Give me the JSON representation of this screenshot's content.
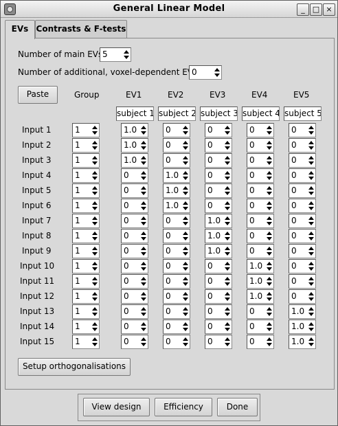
{
  "window": {
    "title": "General Linear Model",
    "min_label": "_",
    "max_label": "□",
    "close_label": "×"
  },
  "tabs": [
    {
      "label": "EVs"
    },
    {
      "label": "Contrasts & F-tests"
    }
  ],
  "main_evs": {
    "label": "Number of main EVs",
    "value": "5"
  },
  "additional_evs": {
    "label": "Number of additional, voxel-dependent EVs",
    "value": "0"
  },
  "paste_label": "Paste",
  "group_header": "Group",
  "ev_headers": [
    "EV1",
    "EV2",
    "EV3",
    "EV4",
    "EV5"
  ],
  "ev_names": [
    "subject 1",
    "subject 2",
    "subject 3",
    "subject 4",
    "subject 5"
  ],
  "rows": [
    {
      "label": "Input 1",
      "group": "1",
      "ev": [
        "1.0",
        "0",
        "0",
        "0",
        "0"
      ]
    },
    {
      "label": "Input 2",
      "group": "1",
      "ev": [
        "1.0",
        "0",
        "0",
        "0",
        "0"
      ]
    },
    {
      "label": "Input 3",
      "group": "1",
      "ev": [
        "1.0",
        "0",
        "0",
        "0",
        "0"
      ]
    },
    {
      "label": "Input 4",
      "group": "1",
      "ev": [
        "0",
        "1.0",
        "0",
        "0",
        "0"
      ]
    },
    {
      "label": "Input 5",
      "group": "1",
      "ev": [
        "0",
        "1.0",
        "0",
        "0",
        "0"
      ]
    },
    {
      "label": "Input 6",
      "group": "1",
      "ev": [
        "0",
        "1.0",
        "0",
        "0",
        "0"
      ]
    },
    {
      "label": "Input 7",
      "group": "1",
      "ev": [
        "0",
        "0",
        "1.0",
        "0",
        "0"
      ]
    },
    {
      "label": "Input 8",
      "group": "1",
      "ev": [
        "0",
        "0",
        "1.0",
        "0",
        "0"
      ]
    },
    {
      "label": "Input 9",
      "group": "1",
      "ev": [
        "0",
        "0",
        "1.0",
        "0",
        "0"
      ]
    },
    {
      "label": "Input 10",
      "group": "1",
      "ev": [
        "0",
        "0",
        "0",
        "1.0",
        "0"
      ]
    },
    {
      "label": "Input 11",
      "group": "1",
      "ev": [
        "0",
        "0",
        "0",
        "1.0",
        "0"
      ]
    },
    {
      "label": "Input 12",
      "group": "1",
      "ev": [
        "0",
        "0",
        "0",
        "1.0",
        "0"
      ]
    },
    {
      "label": "Input 13",
      "group": "1",
      "ev": [
        "0",
        "0",
        "0",
        "0",
        "1.0"
      ]
    },
    {
      "label": "Input 14",
      "group": "1",
      "ev": [
        "0",
        "0",
        "0",
        "0",
        "1.0"
      ]
    },
    {
      "label": "Input 15",
      "group": "1",
      "ev": [
        "0",
        "0",
        "0",
        "0",
        "1.0"
      ]
    }
  ],
  "setup_orth_label": "Setup orthogonalisations",
  "buttons": {
    "view_design": "View design",
    "efficiency": "Efficiency",
    "done": "Done"
  }
}
